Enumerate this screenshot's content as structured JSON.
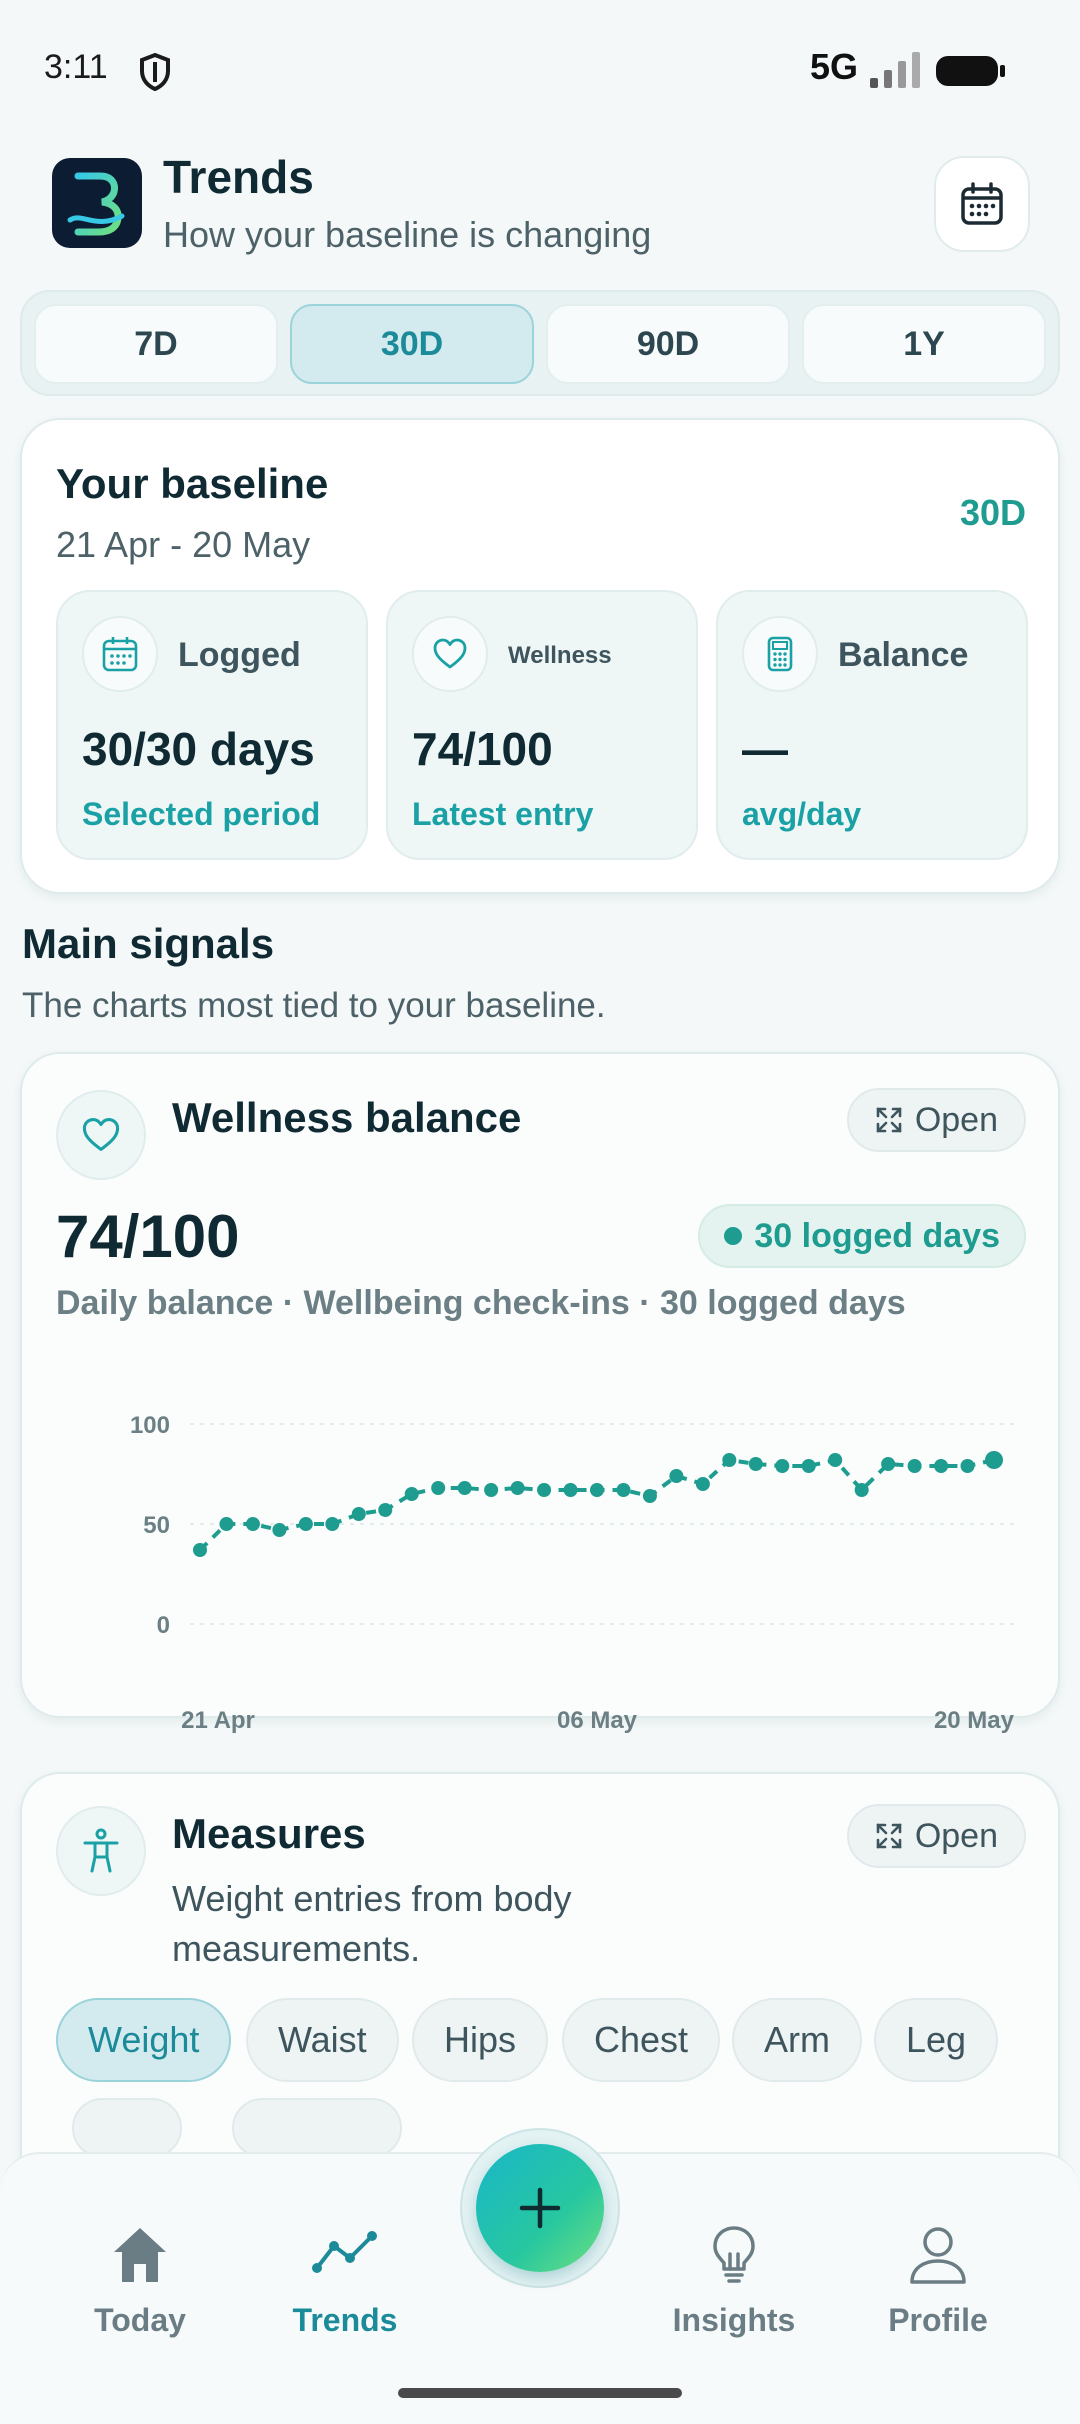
{
  "status_bar": {
    "time": "3:11",
    "network": "5G"
  },
  "header": {
    "title": "Trends",
    "subtitle": "How your baseline is changing"
  },
  "range_tabs": [
    {
      "label": "7D",
      "active": false
    },
    {
      "label": "30D",
      "active": true
    },
    {
      "label": "90D",
      "active": false
    },
    {
      "label": "1Y",
      "active": false
    }
  ],
  "baseline": {
    "title": "Your baseline",
    "date_range": "21 Apr - 20 May",
    "range_badge": "30D",
    "stats": [
      {
        "icon": "calendar-icon",
        "label": "Logged",
        "value": "30/30 days",
        "sub": "Selected period"
      },
      {
        "icon": "heart-icon",
        "label": "Wellness",
        "value": "74/100",
        "sub": "Latest entry"
      },
      {
        "icon": "calculator-icon",
        "label": "Balance",
        "value": "—",
        "sub": "avg/day"
      }
    ]
  },
  "main_signals": {
    "title": "Main signals",
    "subtitle": "The charts most tied to your baseline."
  },
  "wellness": {
    "title": "Wellness balance",
    "open_label": "Open",
    "value": "74/100",
    "pill": "30 logged days",
    "description": "Daily balance · Wellbeing check-ins · 30 logged days"
  },
  "chart_data": {
    "type": "line",
    "x_labels": [
      "21 Apr",
      "06 May",
      "20 May"
    ],
    "x": [
      "21 Apr",
      "22 Apr",
      "23 Apr",
      "24 Apr",
      "25 Apr",
      "26 Apr",
      "27 Apr",
      "28 Apr",
      "29 Apr",
      "30 Apr",
      "01 May",
      "02 May",
      "03 May",
      "04 May",
      "05 May",
      "06 May",
      "07 May",
      "08 May",
      "09 May",
      "10 May",
      "11 May",
      "12 May",
      "13 May",
      "14 May",
      "15 May",
      "16 May",
      "17 May",
      "18 May",
      "19 May",
      "20 May"
    ],
    "series": [
      {
        "values": [
          37,
          50,
          50,
          47,
          50,
          50,
          55,
          57,
          65,
          68,
          68,
          67,
          68,
          67,
          67,
          67,
          67,
          64,
          74,
          70,
          82,
          80,
          79,
          79,
          82,
          67,
          80,
          79,
          79,
          79,
          82
        ]
      }
    ],
    "yticks": [
      0,
      50,
      100
    ],
    "ylim": [
      0,
      100
    ],
    "color": "#1d9c8f",
    "grid": true
  },
  "measures": {
    "title": "Measures",
    "open_label": "Open",
    "description": "Weight entries from body measurements.",
    "chips": [
      {
        "label": "Weight",
        "active": true
      },
      {
        "label": "Waist",
        "active": false
      },
      {
        "label": "Hips",
        "active": false
      },
      {
        "label": "Chest",
        "active": false
      },
      {
        "label": "Arm",
        "active": false
      },
      {
        "label": "Leg",
        "active": false
      }
    ]
  },
  "bottom_nav": [
    {
      "icon": "home-icon",
      "label": "Today",
      "active": false
    },
    {
      "icon": "trend-icon",
      "label": "Trends",
      "active": true
    },
    {
      "icon": "lightbulb-icon",
      "label": "Insights",
      "active": false
    },
    {
      "icon": "user-icon",
      "label": "Profile",
      "active": false
    }
  ],
  "colors": {
    "accent": "#1d9c8f",
    "accent_blue": "#1b8a99",
    "text": "#102a33"
  }
}
